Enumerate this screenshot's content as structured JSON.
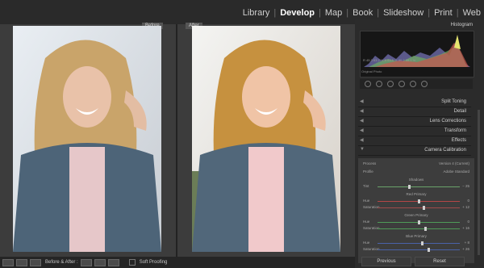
{
  "modules": [
    "Library",
    "Develop",
    "Map",
    "Book",
    "Slideshow",
    "Print",
    "Web"
  ],
  "active_module": "Develop",
  "labels": {
    "before": "Before",
    "after": "After"
  },
  "toolbar": {
    "before_after": "Before & After :",
    "soft_proofing": "Soft Proofing"
  },
  "panel": {
    "histogram_title": "Histogram",
    "readout": "R 45.3 63.2 % B 63.5 % 80.2 55.1 %",
    "original_photo": "Original Photo",
    "sections": [
      "Split Toning",
      "Detail",
      "Lens Corrections",
      "Transform",
      "Effects",
      "Camera Calibration"
    ],
    "calibration": {
      "process_label": "Process",
      "process_value": "Version 4 (Current)",
      "profile_label": "Profile",
      "profile_value": "Adobe Standard",
      "shadows": {
        "title": "Shadows",
        "tint_label": "Tint",
        "tint_value": "− 25"
      },
      "red": {
        "title": "Red Primary",
        "hue_label": "Hue",
        "hue_value": "0",
        "sat_label": "Saturation",
        "sat_value": "+ 12"
      },
      "green": {
        "title": "Green Primary",
        "hue_label": "Hue",
        "hue_value": "0",
        "sat_label": "Saturation",
        "sat_value": "+ 16"
      },
      "blue": {
        "title": "Blue Primary",
        "hue_label": "Hue",
        "hue_value": "+ 8",
        "sat_label": "Saturation",
        "sat_value": "+ 26"
      }
    },
    "previous": "Previous",
    "reset": "Reset"
  },
  "colors": {
    "background": "#1e1e1e",
    "panel": "#2b2b2b",
    "accent_active": "#ffffff"
  }
}
